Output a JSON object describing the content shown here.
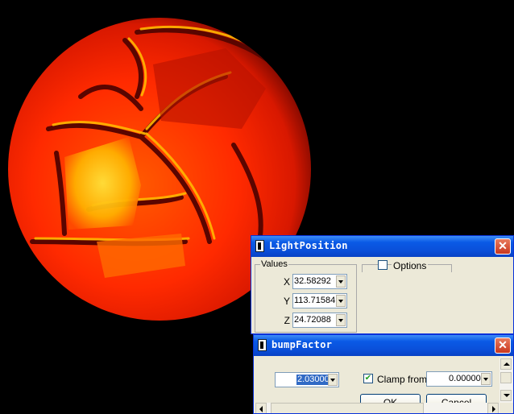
{
  "light_window": {
    "title": "LightPosition",
    "close_glyph": "✕",
    "values_label": "Values",
    "x_label": "X",
    "x_value": "32.58292",
    "y_label": "Y",
    "y_value": "113.71584",
    "z_label": "Z",
    "z_value": "24.72088",
    "options_label": "Options",
    "options_checked": false
  },
  "bump_window": {
    "title": "bumpFactor",
    "close_glyph": "✕",
    "value": "2.03000",
    "clamp_checked": true,
    "clamp_label": "Clamp from",
    "clamp_value": "0.00000",
    "ok_label": "OK",
    "cancel_label": "Cancel"
  },
  "colors": {
    "sphere_outer": "#c81500",
    "sphere_mid": "#ff3a00",
    "sphere_highlight": "#ffd21a",
    "title_blue": "#0a5ae6",
    "dialog_bg": "#ece9d8",
    "selection": "#316ac5"
  },
  "icons": [
    "window-icon",
    "close-icon",
    "dropdown-arrow-icon",
    "checkbox-icon",
    "scroll-arrow-icon"
  ]
}
